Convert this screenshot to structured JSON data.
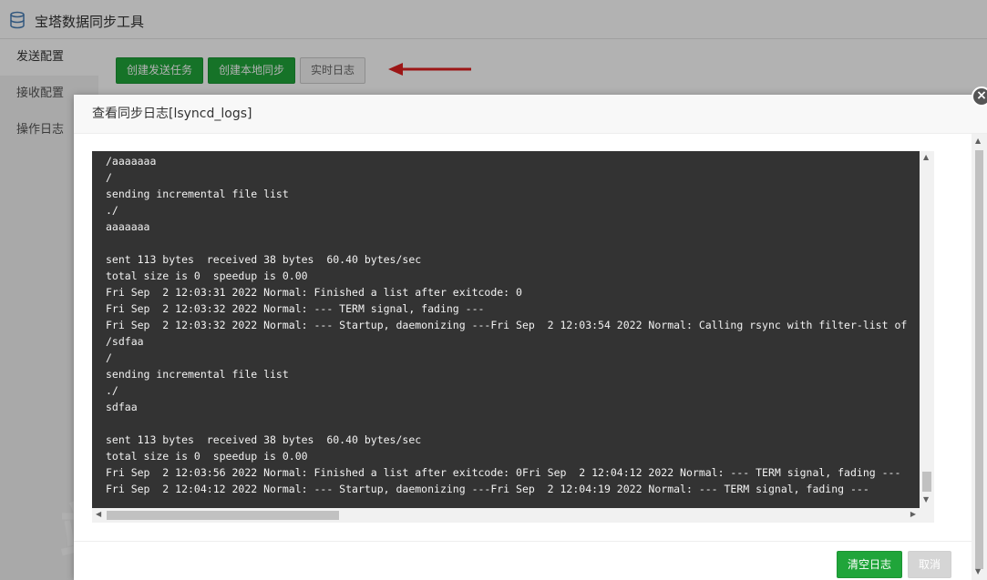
{
  "app": {
    "title": "宝塔数据同步工具"
  },
  "sidebar": {
    "items": [
      {
        "label": "发送配置"
      },
      {
        "label": "接收配置"
      },
      {
        "label": "操作日志"
      }
    ]
  },
  "toolbar": {
    "create_send_task": "创建发送任务",
    "create_local_sync": "创建本地同步",
    "realtime_log": "实时日志"
  },
  "dialog": {
    "title": "查看同步日志[lsyncd_logs]",
    "close_glyph": "×",
    "log_lines": [
      "/aaaaaaa",
      "/",
      "sending incremental file list",
      "./",
      "aaaaaaa",
      "",
      "sent 113 bytes  received 38 bytes  60.40 bytes/sec",
      "total size is 0  speedup is 0.00",
      "Fri Sep  2 12:03:31 2022 Normal: Finished a list after exitcode: 0",
      "Fri Sep  2 12:03:32 2022 Normal: --- TERM signal, fading ---",
      "Fri Sep  2 12:03:32 2022 Normal: --- Startup, daemonizing ---Fri Sep  2 12:03:54 2022 Normal: Calling rsync with filter-list of",
      "/sdfaa",
      "/",
      "sending incremental file list",
      "./",
      "sdfaa",
      "",
      "sent 113 bytes  received 38 bytes  60.40 bytes/sec",
      "total size is 0  speedup is 0.00",
      "Fri Sep  2 12:03:56 2022 Normal: Finished a list after exitcode: 0Fri Sep  2 12:04:12 2022 Normal: --- TERM signal, fading ---",
      "Fri Sep  2 12:04:12 2022 Normal: --- Startup, daemonizing ---Fri Sep  2 12:04:19 2022 Normal: --- TERM signal, fading ---"
    ],
    "clear_log": "清空日志",
    "cancel": "取消"
  },
  "watermark": "站长百科",
  "colors": {
    "primary_green": "#20a53a",
    "log_background": "#333333",
    "arrow_red": "#e02020"
  },
  "icons": {
    "app": "database-icon",
    "close": "close-icon",
    "annotation": "red-arrow-icon"
  }
}
